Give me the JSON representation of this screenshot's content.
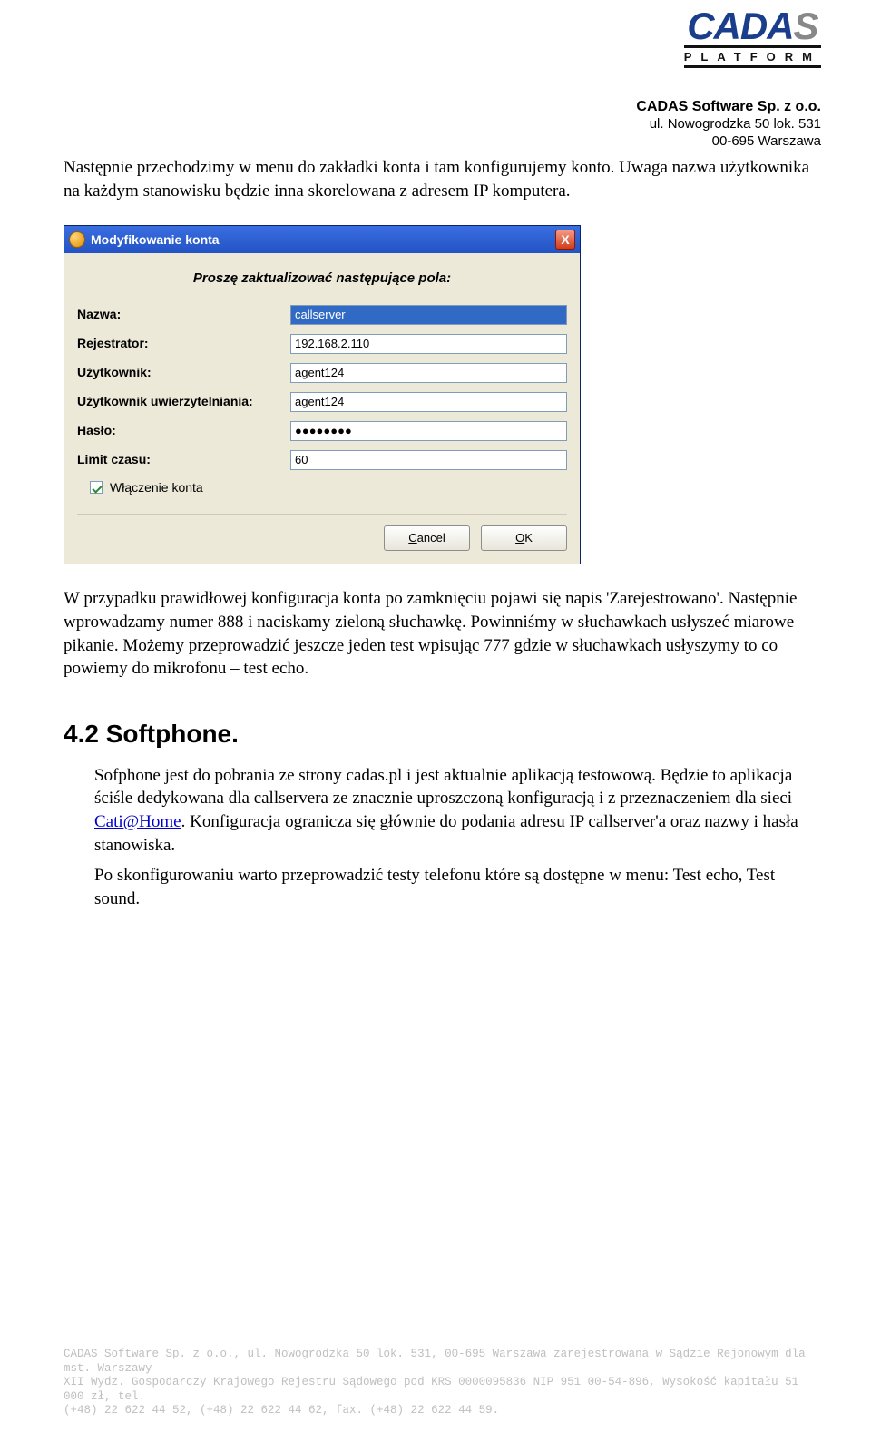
{
  "header": {
    "logo_blue": "CADA",
    "logo_grey": "S",
    "platform": "PLATFORM",
    "company_name": "CADAS Software Sp. z o.o.",
    "addr1": "ul. Nowogrodzka 50 lok. 531",
    "addr2": "00-695 Warszawa"
  },
  "body": {
    "p1": "Następnie przechodzimy w menu do zakładki konta i tam konfigurujemy konto. Uwaga nazwa użytkownika na każdym stanowisku będzie inna skorelowana z adresem IP komputera.",
    "p2": "W przypadku prawidłowej konfiguracja konta po zamknięciu pojawi się napis 'Zarejestrowano'. Następnie wprowadzamy numer 888 i naciskamy zieloną słuchawkę. Powinniśmy w słuchawkach usłyszeć miarowe pikanie. Możemy przeprowadzić jeszcze jeden test wpisując 777 gdzie w słuchawkach usłyszymy to co powiemy do mikrofonu – test echo.",
    "h2": "4.2 Softphone.",
    "p3a": "Sofphone jest do pobrania ze strony cadas.pl i jest aktualnie aplikacją testowową. Będzie to aplikacja ściśle dedykowana dla callservera ze znacznie uproszczoną konfiguracją i z przeznaczeniem dla sieci ",
    "p3_link": "Cati@Home",
    "p3b": ". Konfiguracja ogranicza się głównie do  podania adresu IP callserver'a oraz nazwy i hasła stanowiska.",
    "p4": "Po skonfigurowaniu warto przeprowadzić testy telefonu które są dostępne w menu: Test echo, Test sound."
  },
  "dialog": {
    "title": "Modyfikowanie konta",
    "close": "X",
    "prompt": "Proszę zaktualizować następujące pola:",
    "fields": {
      "name_label": "Nazwa:",
      "name_value": "callserver",
      "reg_label": "Rejestrator:",
      "reg_value": "192.168.2.110",
      "user_label": "Użytkownik:",
      "user_value": "agent124",
      "auth_label": "Użytkownik uwierzytelniania:",
      "auth_value": "agent124",
      "pass_label": "Hasło:",
      "pass_value": "●●●●●●●●",
      "limit_label": "Limit czasu:",
      "limit_value": "60"
    },
    "checkbox": "Włączenie konta",
    "btn_cancel_pre": "",
    "btn_cancel_u": "C",
    "btn_cancel_post": "ancel",
    "btn_ok_pre": "",
    "btn_ok_u": "O",
    "btn_ok_post": "K"
  },
  "footer": {
    "l1": "CADAS Software Sp. z o.o., ul. Nowogrodzka 50 lok. 531, 00-695 Warszawa zarejestrowana w Sądzie Rejonowym dla mst. Warszawy",
    "l2": "XII Wydz. Gospodarczy Krajowego Rejestru Sądowego pod KRS 0000095836 NIP 951 00-54-896, Wysokość kapitału 51 000 zł, tel.",
    "l3": "(+48) 22 622 44 52, (+48) 22 622 44 62, fax. (+48) 22 622 44 59."
  }
}
